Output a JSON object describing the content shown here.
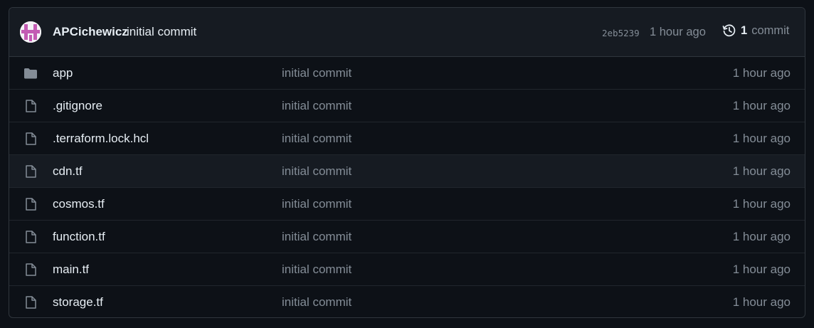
{
  "latest_commit": {
    "author": "APCichewicz",
    "message": "initial commit",
    "sha": "2eb5239",
    "time": "1 hour ago",
    "history_count": "1",
    "history_label": "commit"
  },
  "files": [
    {
      "name": "app",
      "type": "folder",
      "icon": "folder-icon",
      "message": "initial commit",
      "time": "1 hour ago"
    },
    {
      "name": ".gitignore",
      "type": "file",
      "icon": "file-icon",
      "message": "initial commit",
      "time": "1 hour ago"
    },
    {
      "name": ".terraform.lock.hcl",
      "type": "file",
      "icon": "file-icon",
      "message": "initial commit",
      "time": "1 hour ago"
    },
    {
      "name": "cdn.tf",
      "type": "file",
      "icon": "file-icon",
      "message": "initial commit",
      "time": "1 hour ago"
    },
    {
      "name": "cosmos.tf",
      "type": "file",
      "icon": "file-icon",
      "message": "initial commit",
      "time": "1 hour ago"
    },
    {
      "name": "function.tf",
      "type": "file",
      "icon": "file-icon",
      "message": "initial commit",
      "time": "1 hour ago"
    },
    {
      "name": "main.tf",
      "type": "file",
      "icon": "file-icon",
      "message": "initial commit",
      "time": "1 hour ago"
    },
    {
      "name": "storage.tf",
      "type": "file",
      "icon": "file-icon",
      "message": "initial commit",
      "time": "1 hour ago"
    }
  ],
  "colors": {
    "background": "#0d1117",
    "header_background": "#161b22",
    "border": "#30363d",
    "text": "#e6edf3",
    "muted_text": "#848d97",
    "avatar_accent": "#c35bb3"
  }
}
